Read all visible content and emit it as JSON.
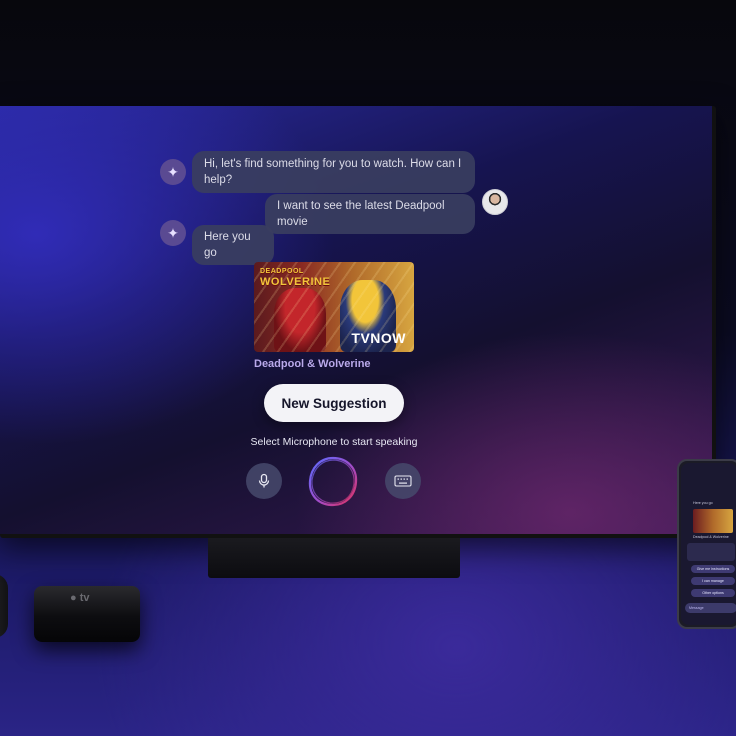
{
  "assistant": {
    "greeting": "Hi, let's find something for you to watch. How can I help?",
    "user_message": "I want to see the latest Deadpool movie",
    "reply": "Here you go"
  },
  "result": {
    "poster_logo_line1": "DEADPOOL",
    "poster_logo_line2": "WOLVERINE",
    "provider_badge": "TVNOW",
    "title": "Deadpool & Wolverine"
  },
  "actions": {
    "new_suggestion": "New Suggestion",
    "hint": "Select Microphone to start speaking"
  },
  "devices": {
    "apple_tv_label": "tv"
  },
  "phone": {
    "bubble1": "Here you go",
    "title": "Deadpool & Wolverine",
    "chip1": "Give me instructions",
    "chip2": "I can manage",
    "chip3": "Other options",
    "input_placeholder": "Message"
  },
  "icons": {
    "bot": "sparkle-icon",
    "mic": "microphone-icon",
    "keyboard": "keyboard-icon",
    "orb": "voice-orb-icon"
  },
  "colors": {
    "accent": "#b9a9ea",
    "bubble": "#3a3e60",
    "button": "#f3f3f7",
    "orb_start": "#5a6cff",
    "orb_end": "#e0305a"
  }
}
